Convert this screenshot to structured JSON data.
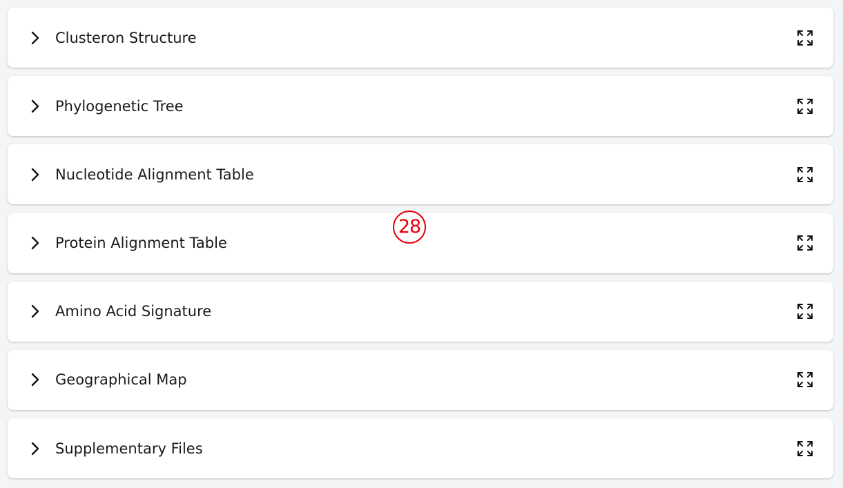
{
  "panels": [
    {
      "title": "Clusteron Structure",
      "expanded": false
    },
    {
      "title": "Phylogenetic Tree",
      "expanded": false
    },
    {
      "title": "Nucleotide Alignment Table",
      "expanded": false
    },
    {
      "title": "Protein Alignment Table",
      "expanded": false
    },
    {
      "title": "Amino Acid Signature",
      "expanded": false
    },
    {
      "title": "Geographical Map",
      "expanded": false
    },
    {
      "title": "Supplementary Files",
      "expanded": false
    }
  ],
  "icons": {
    "toggle": "chevron-right-icon",
    "action": "fullscreen-expand-icon"
  },
  "marker": {
    "label": "28",
    "color": "#e8000b"
  }
}
